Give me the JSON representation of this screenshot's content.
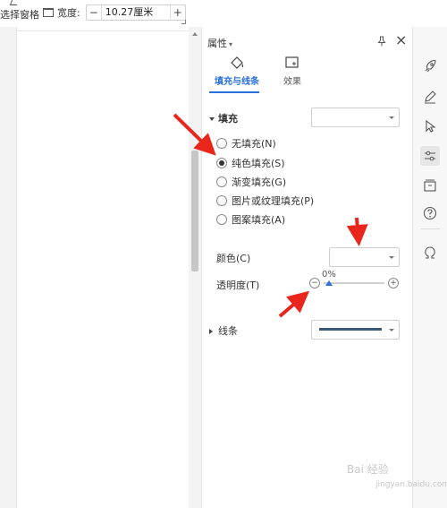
{
  "toolbar": {
    "select_pane_label": "选择窗格",
    "width_label": "宽度:",
    "width_minus": "−",
    "width_value": "10.27厘米",
    "width_plus": "+"
  },
  "panel": {
    "title": "属性",
    "tabs": [
      {
        "label": "填充与线条",
        "active": true
      },
      {
        "label": "效果",
        "active": false
      }
    ],
    "fill_section": {
      "label": "填充",
      "options": [
        {
          "label": "无填充(N)",
          "selected": false
        },
        {
          "label": "纯色填充(S)",
          "selected": true
        },
        {
          "label": "渐变填充(G)",
          "selected": false
        },
        {
          "label": "图片或纹理填充(P)",
          "selected": false
        },
        {
          "label": "图案填充(A)",
          "selected": false
        }
      ],
      "color_label": "颜色(C)",
      "transparency_label": "透明度(T)",
      "transparency_value": "0%",
      "transparency_fraction": 0.0
    },
    "line_section": {
      "label": "线条",
      "line_color": "#3a5a7a"
    }
  },
  "right_rail": {
    "icons": [
      "rocket-icon",
      "pen-icon",
      "cursor-icon",
      "sliders-icon",
      "archive-icon",
      "help-icon",
      "omega-icon"
    ],
    "active": "sliders-icon"
  },
  "watermark": {
    "text": "Bai 经验",
    "sub": "jingyan.baidu.com"
  },
  "colors": {
    "accent": "#2a6fdb",
    "annotation_arrow": "#e8261c"
  }
}
